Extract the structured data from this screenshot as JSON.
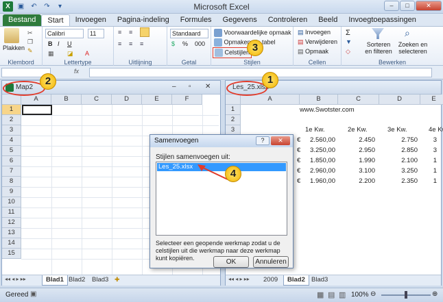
{
  "app": {
    "title": "Microsoft Excel"
  },
  "tabs": [
    "Bestand",
    "Start",
    "Invoegen",
    "Pagina-indeling",
    "Formules",
    "Gegevens",
    "Controleren",
    "Beeld",
    "Invoegtoepassingen"
  ],
  "ribbon": {
    "paste_label": "Plakken",
    "font_name": "Calibri",
    "font_size": "11",
    "number_format": "Standaard",
    "cond_format": "Voorwaardelijke opmaak",
    "format_table": "Opmaken als tabel",
    "cell_styles": "Celstijlen",
    "insert": "Invoegen",
    "delete": "Verwijderen",
    "format": "Opmaak",
    "sort_filter": "Sorteren en filteren",
    "find_select": "Zoeken en selecteren",
    "groups": [
      "Klembord",
      "Lettertype",
      "Uitlijning",
      "Getal",
      "Stijlen",
      "Cellen",
      "Bewerken"
    ]
  },
  "left_window": {
    "title": "Map2",
    "columns": [
      "A",
      "B",
      "C",
      "D",
      "E",
      "F"
    ],
    "rows": [
      "1",
      "2",
      "3",
      "4",
      "5",
      "6",
      "7",
      "8",
      "9",
      "10",
      "11",
      "12",
      "13",
      "14",
      "15"
    ],
    "sheets": [
      "Blad1",
      "Blad2",
      "Blad3"
    ]
  },
  "right_window": {
    "title": "Les_25.xlsx",
    "columns": [
      "A",
      "B",
      "C",
      "D",
      "E"
    ],
    "rows": [
      "1",
      "2",
      "3",
      "4",
      "5",
      "6",
      "7",
      "8"
    ],
    "site": "www.Swotster.com",
    "headers": [
      "1e Kw.",
      "2e Kw.",
      "3e Kw.",
      "4e Kw"
    ],
    "data": [
      [
        "2.560,00",
        "2.450",
        "2.750",
        "3"
      ],
      [
        "3.250,00",
        "2.950",
        "2.850",
        "3"
      ],
      [
        "1.850,00",
        "1.990",
        "2.100",
        "1"
      ],
      [
        "2.960,00",
        "3.100",
        "3.250",
        "1"
      ],
      [
        "1.960,00",
        "2.200",
        "2.350",
        "1"
      ]
    ],
    "currency": "€",
    "sheets": [
      "2009",
      "Blad2",
      "Blad3"
    ]
  },
  "dialog": {
    "title": "Samenvoegen",
    "help": "?",
    "list_label": "Stijlen samenvoegen uit:",
    "list_items": [
      "Les_25.xlsx"
    ],
    "description": "Selecteer een geopende werkmap zodat u de celstijlen uit die werkmap naar deze werkmap kunt kopiëren.",
    "ok": "OK",
    "cancel": "Annuleren"
  },
  "status": {
    "ready": "Gereed",
    "zoom": "100%"
  },
  "badges": [
    "1",
    "2",
    "3",
    "4"
  ]
}
